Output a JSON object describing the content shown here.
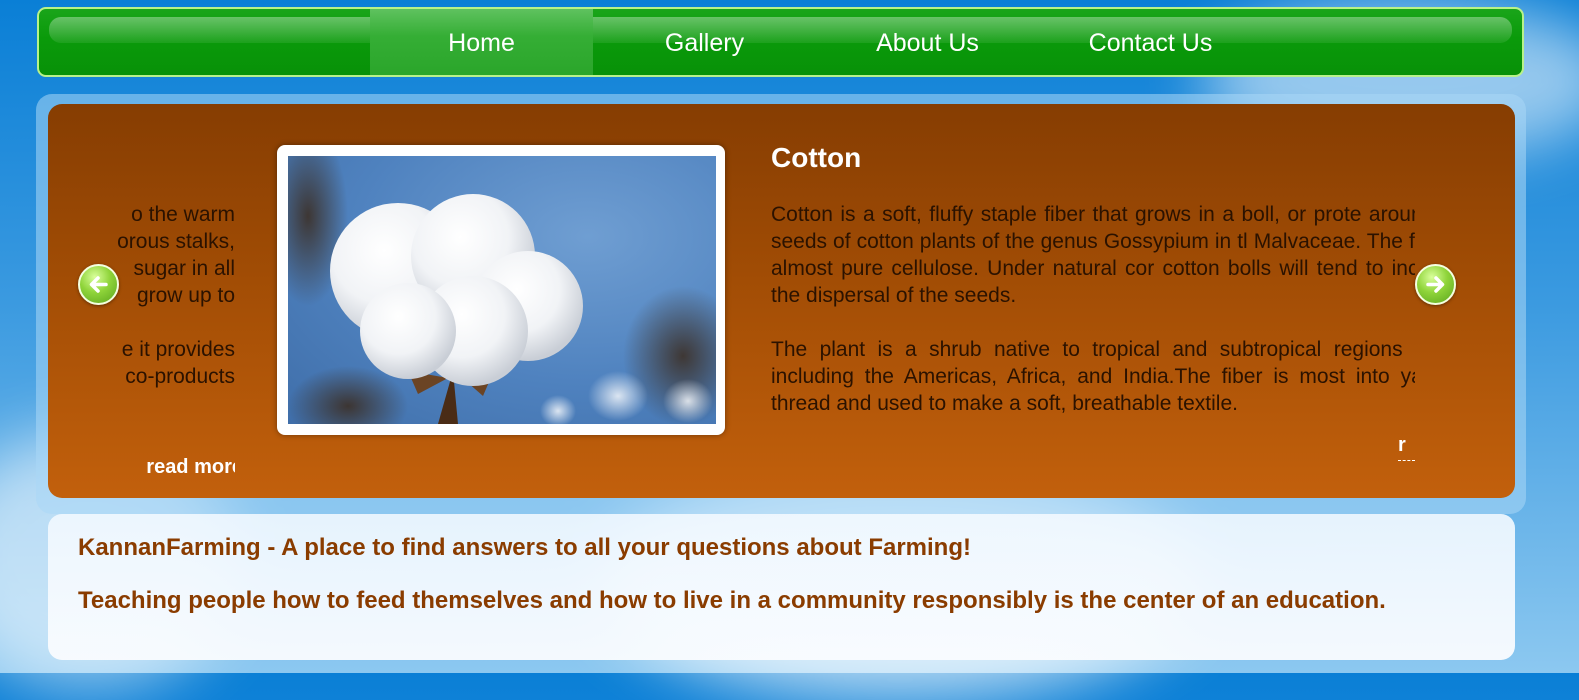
{
  "nav": {
    "items": [
      {
        "label": "Home",
        "active": true
      },
      {
        "label": "Gallery",
        "active": false
      },
      {
        "label": "About Us",
        "active": false
      },
      {
        "label": "Contact Us",
        "active": false
      }
    ]
  },
  "slider": {
    "prev_slide": {
      "text_fragments": [
        "o the warm",
        "orous stalks,",
        "sugar in all",
        "grow up to",
        "",
        "e it provides",
        "co-products"
      ],
      "read_more": "read more"
    },
    "current_slide": {
      "title": "Cotton",
      "image_alt": "Cotton boll",
      "paragraph1": "Cotton is a soft, fluffy staple fiber that grows in a boll, or prote around the seeds of cotton plants of the genus Gossypium in tl Malvaceae. The fiber is almost pure cellulose. Under natural cor cotton bolls will tend to increase the dispersal of the seeds.",
      "paragraph2": "The plant is a shrub native to tropical and subtropical regions world, including the Americas, Africa, and India.The fiber is most into yarn or thread and used to make a soft, breathable textile.",
      "read_more": "r"
    },
    "prev_arrow": "arrow-left-icon",
    "next_arrow": "arrow-right-icon"
  },
  "info": {
    "line1": "KannanFarming - A place to find answers to all your questions about Farming!",
    "line2": "Teaching people how to feed themselves and how to live in a community responsibly is the center of an education."
  },
  "colors": {
    "nav_green": "#0a9a0a",
    "slider_brown": "#a24d05",
    "info_text": "#8a3c00"
  }
}
